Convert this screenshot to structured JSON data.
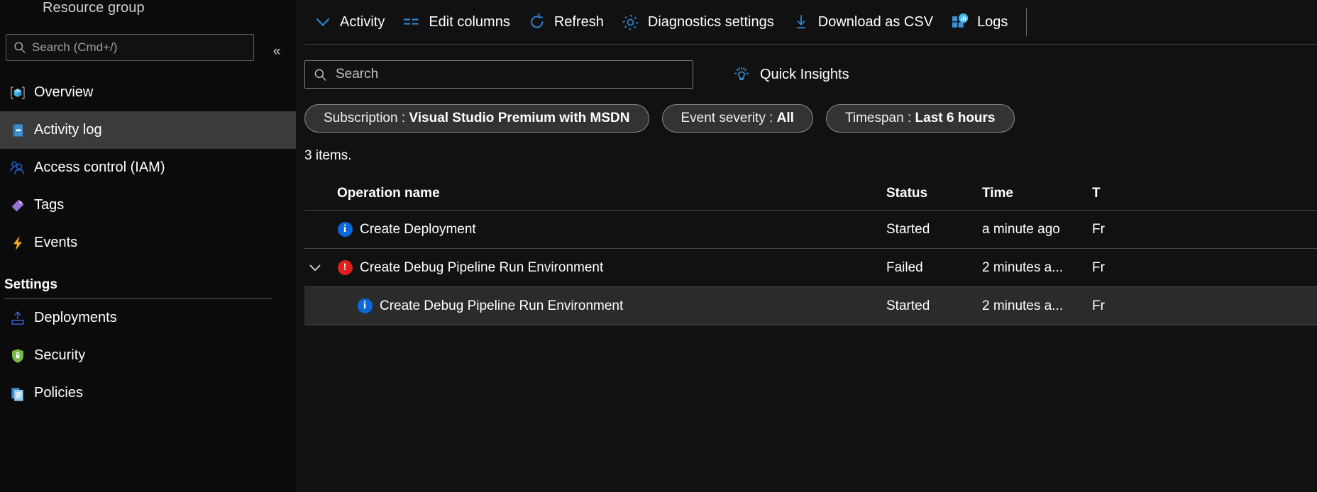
{
  "sidebar": {
    "resource_group_title": "Resource group",
    "search": {
      "placeholder": "Search (Cmd+/)",
      "value": "",
      "icon": "search-icon"
    },
    "collapse_icon": "«",
    "items": [
      {
        "label": "Overview",
        "icon": "cube-icon",
        "selected": false
      },
      {
        "label": "Activity log",
        "icon": "activity-log-icon",
        "selected": true
      },
      {
        "label": "Access control (IAM)",
        "icon": "people-icon",
        "selected": false
      },
      {
        "label": "Tags",
        "icon": "tag-icon",
        "selected": false
      },
      {
        "label": "Events",
        "icon": "lightning-icon",
        "selected": false
      }
    ],
    "section_title": "Settings",
    "settings_items": [
      {
        "label": "Deployments",
        "icon": "upload-icon",
        "selected": false
      },
      {
        "label": "Security",
        "icon": "shield-lock-icon",
        "selected": false
      },
      {
        "label": "Policies",
        "icon": "documents-icon",
        "selected": false
      }
    ]
  },
  "toolbar": {
    "buttons": [
      {
        "label": "Activity",
        "icon": "chevron-down-icon"
      },
      {
        "label": "Edit columns",
        "icon": "edit-columns-icon"
      },
      {
        "label": "Refresh",
        "icon": "refresh-icon"
      },
      {
        "label": "Diagnostics settings",
        "icon": "gear-icon"
      },
      {
        "label": "Download as CSV",
        "icon": "download-icon"
      },
      {
        "label": "Logs",
        "icon": "logs-icon"
      }
    ]
  },
  "filters": {
    "search": {
      "placeholder": "Search",
      "value": "",
      "icon": "search-icon"
    },
    "quick_insights": {
      "label": "Quick Insights",
      "icon": "lightbulb-icon"
    },
    "pills": [
      {
        "name": "Subscription",
        "separator": " : ",
        "value": "Visual Studio Premium with MSDN"
      },
      {
        "name": "Event severity",
        "separator": " : ",
        "value": "All"
      },
      {
        "name": "Timespan",
        "separator": " : ",
        "value": "Last 6 hours"
      }
    ]
  },
  "results": {
    "count_label": "3 items.",
    "columns": {
      "operation_name": "Operation name",
      "status": "Status",
      "time": "Time",
      "time_grain": "T"
    },
    "rows": [
      {
        "operation_name": "Create Deployment",
        "severity_icon": "info-icon",
        "status": "Started",
        "time": "a minute ago",
        "time_grain": "Fr",
        "expandable": false,
        "indent": 0,
        "selected": false
      },
      {
        "operation_name": "Create Debug Pipeline Run Environment",
        "severity_icon": "error-icon",
        "status": "Failed",
        "time": "2 minutes a...",
        "time_grain": "Fr",
        "expandable": true,
        "expanded": true,
        "indent": 0,
        "selected": false
      },
      {
        "operation_name": "Create Debug Pipeline Run Environment",
        "severity_icon": "info-icon",
        "status": "Started",
        "time": "2 minutes a...",
        "time_grain": "Fr",
        "expandable": false,
        "indent": 1,
        "selected": true
      }
    ]
  },
  "colors": {
    "accent": "#3b8fd6",
    "link": "#4a9bea",
    "selected_row": "#2b2b2b",
    "selected_nav": "#3b3b3b",
    "info_badge": "#0b68d9",
    "error_badge": "#e01f1f",
    "background": "#111111",
    "sidebar_background": "#0b0b0b"
  }
}
